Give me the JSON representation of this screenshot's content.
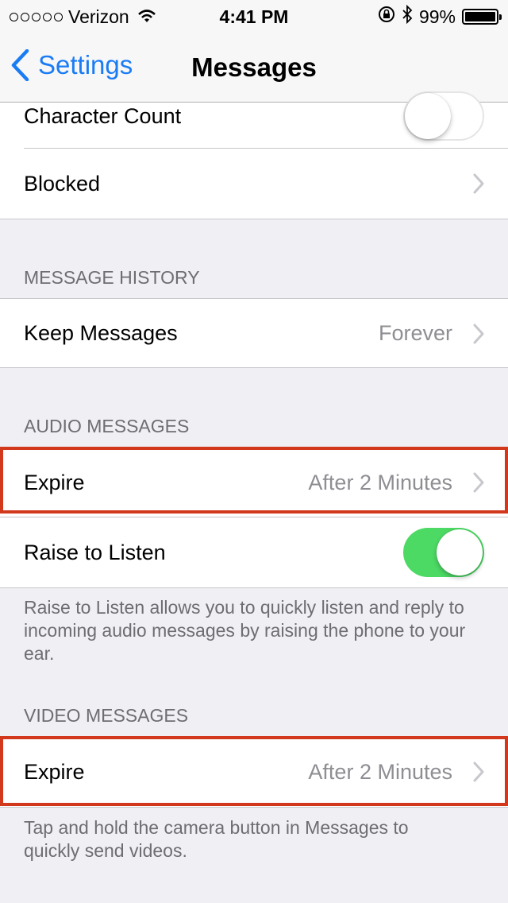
{
  "status_bar": {
    "carrier": "Verizon",
    "time": "4:41 PM",
    "battery": "99%",
    "battery_level": 0.99,
    "icons": [
      "signal-dots-icon",
      "wifi-icon",
      "rotation-lock-icon",
      "bluetooth-icon",
      "battery-icon"
    ]
  },
  "nav": {
    "back_label": "Settings",
    "title": "Messages"
  },
  "rows": {
    "character_count": {
      "label": "Character Count",
      "toggle_on": false
    },
    "blocked": {
      "label": "Blocked"
    },
    "keep_messages": {
      "label": "Keep Messages",
      "value": "Forever"
    },
    "audio_expire": {
      "label": "Expire",
      "value": "After 2 Minutes"
    },
    "raise_to_listen": {
      "label": "Raise to Listen",
      "toggle_on": true
    },
    "video_expire": {
      "label": "Expire",
      "value": "After 2 Minutes"
    }
  },
  "sections": {
    "message_history": {
      "header": "MESSAGE HISTORY"
    },
    "audio_messages": {
      "header": "AUDIO MESSAGES",
      "footer": "Raise to Listen allows you to quickly listen and reply to incoming audio messages by raising the phone to your ear."
    },
    "video_messages": {
      "header": "VIDEO MESSAGES",
      "footer": "Tap and hold the camera button in Messages to quickly send videos."
    }
  },
  "colors": {
    "accent": "#1a7cf5",
    "toggle_on": "#4cd964",
    "highlight_box": "#d2381c",
    "background": "#efeff4"
  }
}
